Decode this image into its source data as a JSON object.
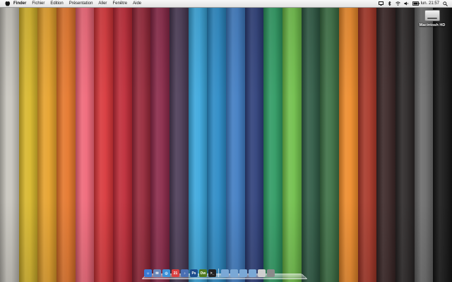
{
  "menubar": {
    "apple_icon": "apple-logo-icon",
    "items": [
      {
        "label": "Finder",
        "bold": true
      },
      {
        "label": "Fichier"
      },
      {
        "label": "Edition"
      },
      {
        "label": "Présentation"
      },
      {
        "label": "Aller"
      },
      {
        "label": "Fenêtre"
      },
      {
        "label": "Aide"
      }
    ],
    "status_icons": [
      "display-icon",
      "bluetooth-icon",
      "wifi-icon",
      "volume-icon",
      "battery-icon"
    ],
    "clock": "lun. 21:57",
    "spotlight_icon": "spotlight-icon"
  },
  "desktop": {
    "hd_label": "Macintosh HD"
  },
  "wallpaper": {
    "stripe_colors": [
      "#c8c5bd",
      "#d8b62a",
      "#e6a12a",
      "#e5762a",
      "#f06677",
      "#d8363a",
      "#bf2a37",
      "#962739",
      "#8a2848",
      "#4a3a55",
      "#3aa7dd",
      "#2a8ac6",
      "#3f7cc2",
      "#2d3f7a",
      "#2e9a62",
      "#6fbf4a",
      "#2f5a44",
      "#3c6f44",
      "#ef8b2a",
      "#a83728",
      "#3a2626",
      "#2a2626",
      "#6a6a6a",
      "#151515"
    ]
  },
  "dock": {
    "apps": [
      {
        "name": "finder-app-icon",
        "color": "#3a7bd5",
        "glyph": "☺"
      },
      {
        "name": "mail-app-icon",
        "color": "#6a87b8",
        "glyph": "✉"
      },
      {
        "name": "safari-app-icon",
        "color": "#3e91d8",
        "glyph": "◎"
      },
      {
        "name": "ical-app-icon",
        "color": "#d94141",
        "glyph": "21"
      },
      {
        "name": "itunes-app-icon",
        "color": "#4a6fb3",
        "glyph": "♪"
      },
      {
        "name": "photoshop-app-icon",
        "color": "#1c4c8c",
        "glyph": "Ps"
      },
      {
        "name": "dreamweaver-app-icon",
        "color": "#4f7a1f",
        "glyph": "Dw"
      },
      {
        "name": "terminal-app-icon",
        "color": "#222222",
        "glyph": ">_"
      },
      {
        "name": "applications-folder-icon",
        "color": "#7aa8d6",
        "glyph": ""
      },
      {
        "name": "documents-folder-icon",
        "color": "#7aa8d6",
        "glyph": ""
      },
      {
        "name": "downloads-folder-icon",
        "color": "#7aa8d6",
        "glyph": ""
      },
      {
        "name": "pictures-folder-icon",
        "color": "#7aa8d6",
        "glyph": ""
      },
      {
        "name": "drive-icon",
        "color": "#cfcfcf",
        "glyph": ""
      },
      {
        "name": "trash-icon",
        "color": "#8a8a8a",
        "glyph": ""
      }
    ]
  }
}
